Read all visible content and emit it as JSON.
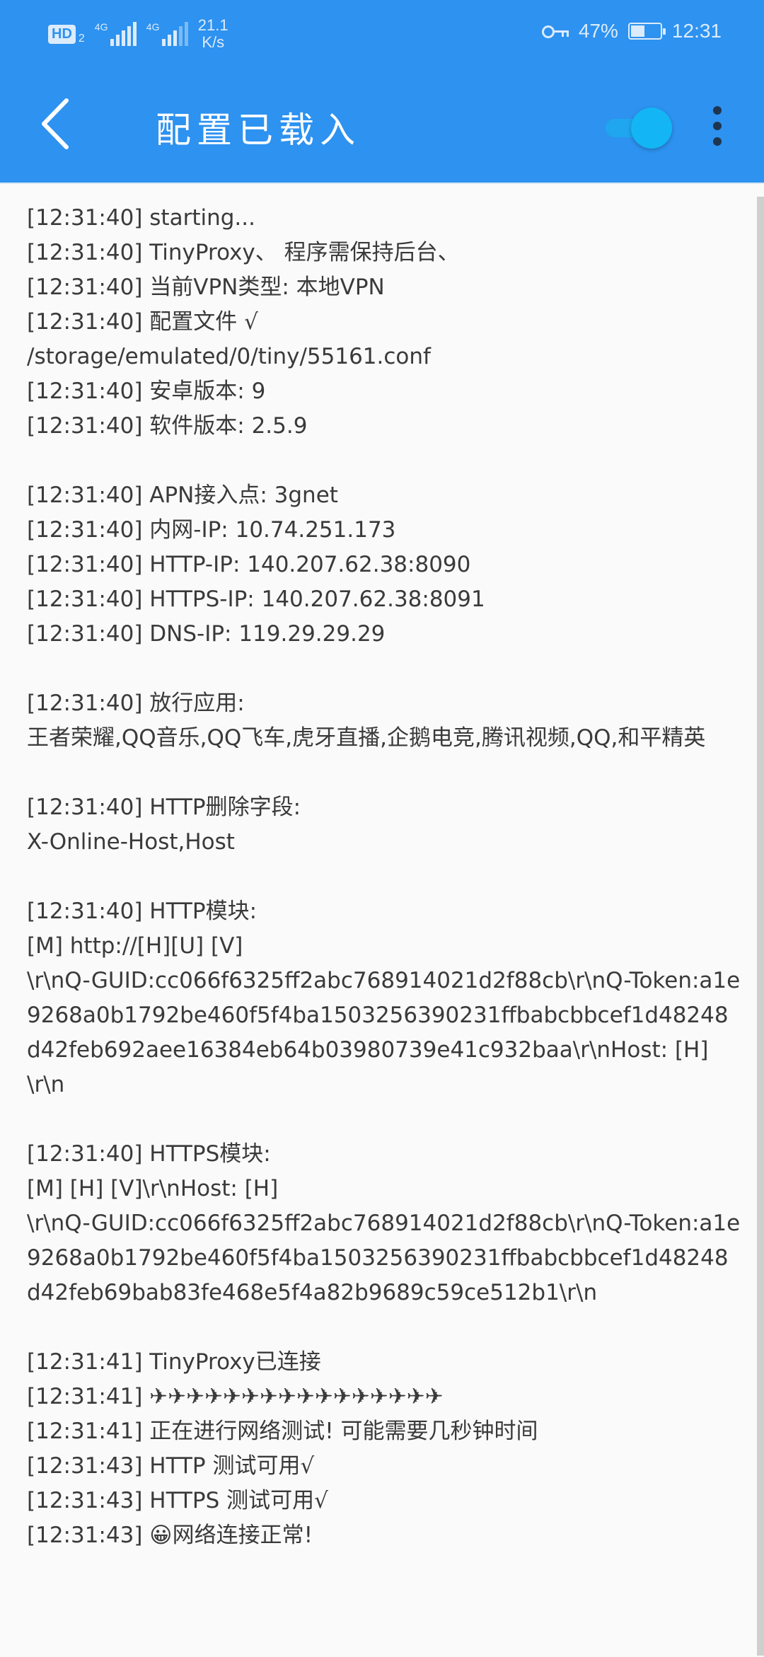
{
  "status_bar": {
    "hd_label": "HD",
    "hd_sub": "2",
    "net1": "4G",
    "net2": "4G",
    "speed_value": "21.1",
    "speed_unit": "K/s",
    "battery": "47%",
    "battery_level": 0.47,
    "time": "12:31"
  },
  "app_bar": {
    "title": "配置已载入",
    "toggle_on": true,
    "accent_color": "#2d92f0"
  },
  "log": {
    "lines": [
      "[12:31:40] starting...",
      "[12:31:40] TinyProxy、 程序需保持后台、",
      "[12:31:40] 当前VPN类型: 本地VPN",
      "[12:31:40] 配置文件 √",
      "/storage/emulated/0/tiny/55161.conf",
      "[12:31:40] 安卓版本: 9",
      "[12:31:40] 软件版本: 2.5.9",
      "",
      "[12:31:40] APN接入点: 3gnet",
      "[12:31:40] 内网-IP: 10.74.251.173",
      "[12:31:40] HTTP-IP: 140.207.62.38:8090",
      "[12:31:40] HTTPS-IP: 140.207.62.38:8091",
      "[12:31:40] DNS-IP: 119.29.29.29",
      "",
      "[12:31:40] 放行应用:",
      "王者荣耀,QQ音乐,QQ飞车,虎牙直播,企鹅电竞,腾讯视频,QQ,和平精英",
      "",
      "[12:31:40] HTTP删除字段:",
      "X-Online-Host,Host",
      "",
      "[12:31:40] HTTP模块:",
      "[M] http://[H][U] [V]",
      "\\r\\nQ-GUID:cc066f6325ff2abc768914021d2f88cb\\r\\nQ-Token:a1e9268a0b1792be460f5f4ba1503256390231ffbabcbbcef1d48248d42feb692aee16384eb64b03980739e41c932baa\\r\\nHost: [H]",
      "\\r\\n",
      "",
      "[12:31:40] HTTPS模块:",
      "[M] [H] [V]\\r\\nHost: [H]",
      "\\r\\nQ-GUID:cc066f6325ff2abc768914021d2f88cb\\r\\nQ-Token:a1e9268a0b1792be460f5f4ba1503256390231ffbabcbbcef1d48248d42feb69bab83fe468e5f4a82b9689c59ce512b1\\r\\n",
      "",
      "[12:31:41] TinyProxy已连接",
      "[12:31:41] ✈✈✈✈✈✈✈✈✈✈✈✈✈✈✈✈",
      "[12:31:41] 正在进行网络测试! 可能需要几秒钟时间",
      "[12:31:43] HTTP 测试可用√",
      "[12:31:43] HTTPS 测试可用√",
      "[12:31:43] 😀网络连接正常!"
    ]
  }
}
